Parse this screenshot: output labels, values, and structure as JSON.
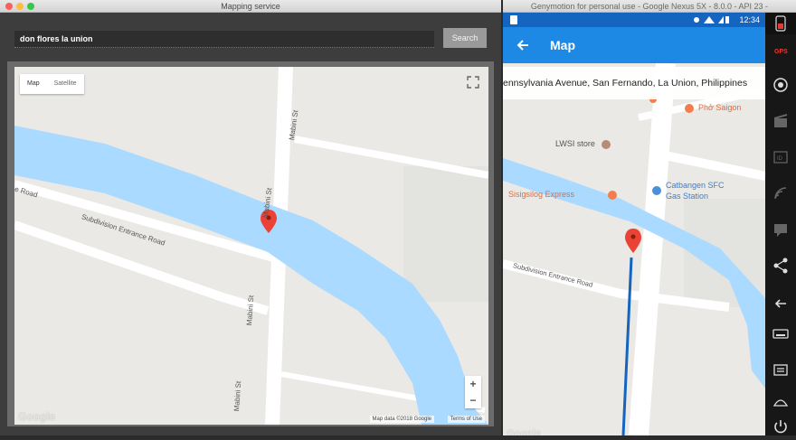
{
  "left_window": {
    "title": "Mapping service",
    "search_value": "don flores la union",
    "search_button": "Search",
    "map": {
      "toggle_map": "Map",
      "toggle_satellite": "Satellite",
      "roads": [
        "Mabini St",
        "Mabini St",
        "Mabini St",
        "Mabini St",
        "Subdivision Entrance Road",
        "e Road"
      ],
      "zoom_in": "+",
      "zoom_out": "−",
      "attribution": "Map data ©2018 Google",
      "terms": "Terms of Use",
      "logo": "Google"
    }
  },
  "emulator": {
    "title": "Genymotion for personal use - Google Nexus 5X - 8.0.0 - API 23 -",
    "status_time": "12:34",
    "appbar_title": "Map",
    "address": "ennsylvania Avenue, San Fernando, La Union, Philippines",
    "places": [
      "Phở Saigon",
      "LWSI store",
      "Catbangen SFC",
      "Gas Station",
      "Sisigsilog Express"
    ],
    "roads": [
      "Subdivision Entrance Road"
    ],
    "logo": "Google"
  },
  "colors": {
    "water": "#aadaff",
    "pin": "#ea4335",
    "appbar": "#1e88e5",
    "statusbar": "#1565c0",
    "route": "#1565c0"
  },
  "icons": [
    "back-arrow-icon",
    "fullscreen-icon",
    "map-pin-icon",
    "restaurant-icon",
    "shop-icon",
    "gas-station-icon",
    "gps-icon",
    "camera-icon",
    "clapper-icon",
    "id-icon",
    "wifi-icon",
    "sms-icon",
    "share-icon",
    "back-icon",
    "keyboard-icon",
    "menu-icon",
    "home-icon",
    "power-icon"
  ]
}
